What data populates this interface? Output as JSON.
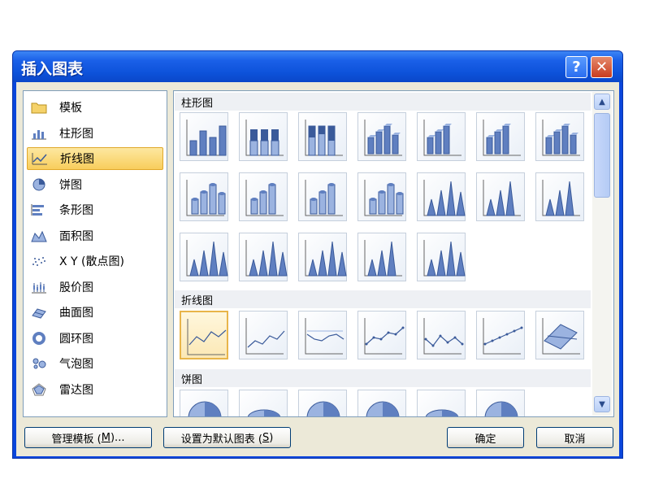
{
  "dialog": {
    "title": "插入图表",
    "help_label": "?",
    "close_label": "✕"
  },
  "categories": [
    {
      "label": "模板",
      "icon": "folder-icon"
    },
    {
      "label": "柱形图",
      "icon": "column-chart-icon"
    },
    {
      "label": "折线图",
      "icon": "line-chart-icon",
      "selected": true
    },
    {
      "label": "饼图",
      "icon": "pie-chart-icon"
    },
    {
      "label": "条形图",
      "icon": "bar-chart-icon"
    },
    {
      "label": "面积图",
      "icon": "area-chart-icon"
    },
    {
      "label": "X Y (散点图)",
      "icon": "scatter-chart-icon"
    },
    {
      "label": "股价图",
      "icon": "stock-chart-icon"
    },
    {
      "label": "曲面图",
      "icon": "surface-chart-icon"
    },
    {
      "label": "圆环图",
      "icon": "doughnut-chart-icon"
    },
    {
      "label": "气泡图",
      "icon": "bubble-chart-icon"
    },
    {
      "label": "雷达图",
      "icon": "radar-chart-icon"
    }
  ],
  "gallery": {
    "column_header": "柱形图",
    "line_header": "折线图",
    "pie_header": "饼图"
  },
  "buttons": {
    "manage_templates_prefix": "管理模板 (",
    "manage_templates_key": "M",
    "manage_templates_suffix": ")...",
    "set_default_prefix": "设置为默认图表 (",
    "set_default_key": "S",
    "set_default_suffix": ")",
    "ok": "确定",
    "cancel": "取消"
  },
  "colors": {
    "title_bar": "#0d52da",
    "selection": "#f8cd5c",
    "chart_blue": "#5f7fc0"
  }
}
